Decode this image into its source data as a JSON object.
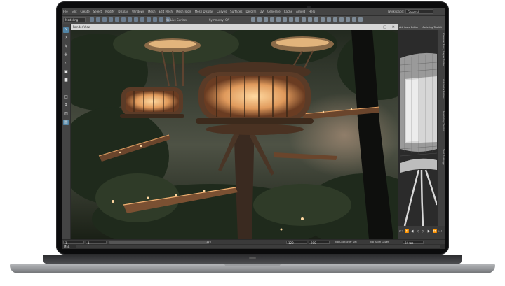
{
  "menu": {
    "items": [
      "File",
      "Edit",
      "Create",
      "Select",
      "Modify",
      "Display",
      "Windows",
      "Mesh",
      "Edit Mesh",
      "Mesh Tools",
      "Mesh Display",
      "Curves",
      "Surfaces",
      "Deform",
      "UV",
      "Generate",
      "Cache",
      "Arnold",
      "Help"
    ],
    "workspace_label": "Workspace:",
    "workspace_value": "General"
  },
  "status_line": {
    "mode": "Modeling",
    "live_surface": "No Live Surface",
    "symmetry": "Symmetry: Off"
  },
  "viewport": {
    "title": "Render View"
  },
  "side_panel": {
    "tabs": [
      "Attribute Editor",
      "Modeling Toolkit"
    ],
    "vertical_labels": [
      "Channel Box / Layer Editor",
      "Attribute Editor",
      "Modeling Toolkit",
      "Tool Settings"
    ]
  },
  "range_bar": {
    "start": "1",
    "current": "1",
    "end_slider": "120",
    "range_end": "120",
    "anim_end": "200",
    "character_set": "No Character Set",
    "anim_layer": "No Anim Layer",
    "fps": "24 fps"
  },
  "command_line": {
    "label": "MEL"
  },
  "colors": {
    "ui_dark": "#3b3b3b",
    "lid": "#0b0b0c",
    "warm_light": "#f0b070",
    "foliage": "#1f2a1c"
  }
}
